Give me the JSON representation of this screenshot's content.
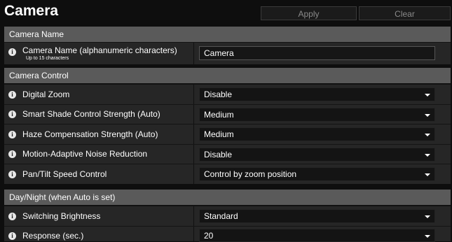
{
  "header": {
    "title": "Camera",
    "apply_label": "Apply",
    "clear_label": "Clear"
  },
  "sections": {
    "camera_name": {
      "title": "Camera Name",
      "name_label": "Camera Name (alphanumeric characters)",
      "name_sub": "Up to 15 characters",
      "name_value": "Camera"
    },
    "camera_control": {
      "title": "Camera Control",
      "digital_zoom": {
        "label": "Digital Zoom",
        "value": "Disable"
      },
      "smart_shade": {
        "label": "Smart Shade Control Strength (Auto)",
        "value": "Medium"
      },
      "haze": {
        "label": "Haze Compensation Strength (Auto)",
        "value": "Medium"
      },
      "noise": {
        "label": "Motion-Adaptive Noise Reduction",
        "value": "Disable"
      },
      "pan_tilt": {
        "label": "Pan/Tilt Speed Control",
        "value": "Control by zoom position"
      }
    },
    "day_night": {
      "title": "Day/Night (when Auto is set)",
      "switching": {
        "label": "Switching Brightness",
        "value": "Standard"
      },
      "response": {
        "label": "Response (sec.)",
        "value": "20"
      }
    }
  },
  "icons": {
    "info": "info-icon",
    "dropdown": "chevron-down-icon"
  },
  "colors": {
    "background": "#0e0e0e",
    "section_bar": "#5a5a5a",
    "row": "#262626"
  }
}
